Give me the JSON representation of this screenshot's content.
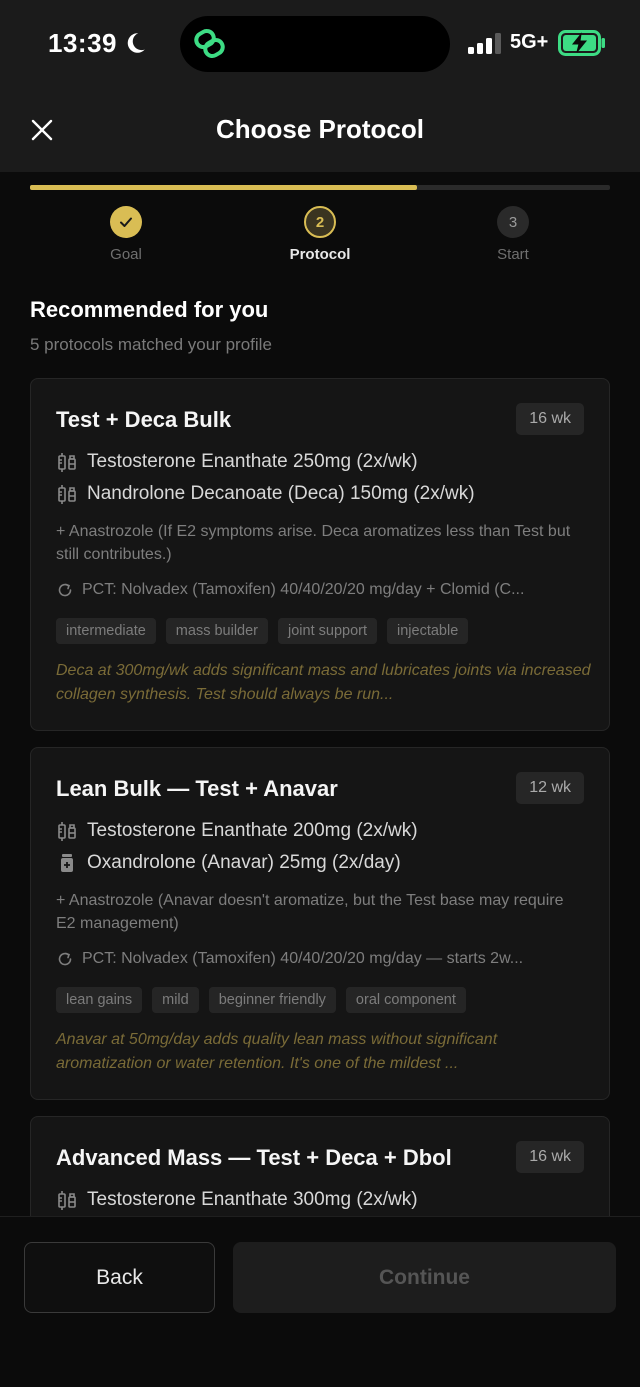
{
  "status_bar": {
    "time": "13:39",
    "network": "5G+"
  },
  "header": {
    "title": "Choose Protocol"
  },
  "progress": {
    "fraction": 0.667
  },
  "steps": [
    {
      "label": "Goal",
      "number": "1",
      "state": "done"
    },
    {
      "label": "Protocol",
      "number": "2",
      "state": "active"
    },
    {
      "label": "Start",
      "number": "3",
      "state": "pending"
    }
  ],
  "section": {
    "title": "Recommended for you",
    "subtitle": "5 protocols matched your profile"
  },
  "protocols": [
    {
      "title": "Test + Deca Bulk",
      "duration": "16 wk",
      "compounds": [
        {
          "icon": "syringe-icon",
          "text": "Testosterone Enanthate 250mg (2x/wk)"
        },
        {
          "icon": "syringe-icon",
          "text": "Nandrolone Decanoate (Deca) 150mg (2x/wk)"
        }
      ],
      "ancillary": "+ Anastrozole (If E2 symptoms arise. Deca aromatizes less than Test but still contributes.)",
      "pct": "PCT: Nolvadex (Tamoxifen) 40/40/20/20 mg/day + Clomid (C...",
      "tags": [
        "intermediate",
        "mass builder",
        "joint support",
        "injectable"
      ],
      "note": "Deca at 300mg/wk adds significant mass and lubricates joints via increased collagen synthesis. Test should always be run..."
    },
    {
      "title": "Lean Bulk — Test + Anavar",
      "duration": "12 wk",
      "compounds": [
        {
          "icon": "syringe-icon",
          "text": "Testosterone Enanthate 200mg (2x/wk)"
        },
        {
          "icon": "pill-bottle-icon",
          "text": "Oxandrolone (Anavar) 25mg (2x/day)"
        }
      ],
      "ancillary": "+ Anastrozole (Anavar doesn't aromatize, but the Test base may require E2 management)",
      "pct": "PCT: Nolvadex (Tamoxifen) 40/40/20/20 mg/day — starts 2w...",
      "tags": [
        "lean gains",
        "mild",
        "beginner friendly",
        "oral component"
      ],
      "note": "Anavar at 50mg/day adds quality lean mass without significant aromatization or water retention. It's one of the mildest ..."
    },
    {
      "title": "Advanced Mass — Test + Deca + Dbol",
      "duration": "16 wk",
      "compounds": [
        {
          "icon": "syringe-icon",
          "text": "Testosterone Enanthate 300mg (2x/wk)"
        }
      ]
    }
  ],
  "footer": {
    "back_label": "Back",
    "continue_label": "Continue"
  }
}
